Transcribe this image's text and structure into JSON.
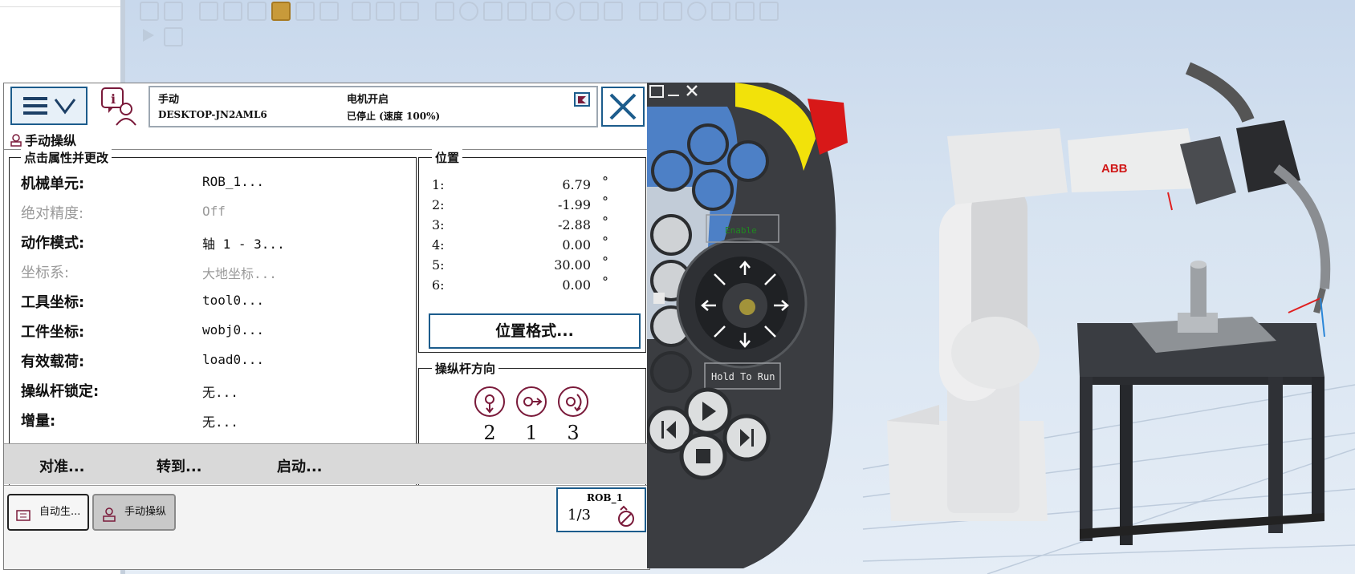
{
  "pendant": {
    "mode": "手动",
    "host": "DESKTOP-JN2AML6",
    "motor_state": "电机开启",
    "run_state": "已停止 (速度 100%)",
    "view_title": "手动操纵"
  },
  "properties": {
    "group_title": "点击属性并更改",
    "rows": [
      {
        "label": "机械单元:",
        "value": "ROB_1...",
        "enabled": true
      },
      {
        "label": "绝对精度:",
        "value": "Off",
        "enabled": false
      },
      {
        "label": "动作模式:",
        "value": "轴 1 - 3...",
        "enabled": true
      },
      {
        "label": "坐标系:",
        "value": "大地坐标...",
        "enabled": false
      },
      {
        "label": "工具坐标:",
        "value": "tool0...",
        "enabled": true
      },
      {
        "label": "工件坐标:",
        "value": "wobj0...",
        "enabled": true
      },
      {
        "label": "有效载荷:",
        "value": "load0...",
        "enabled": true
      },
      {
        "label": "操纵杆锁定:",
        "value": "无...",
        "enabled": true
      },
      {
        "label": "增量:",
        "value": "无...",
        "enabled": true
      }
    ]
  },
  "position": {
    "group_title": "位置",
    "unit": "°",
    "axes": [
      {
        "axis": "1:",
        "value": "6.79"
      },
      {
        "axis": "2:",
        "value": "-1.99"
      },
      {
        "axis": "3:",
        "value": "-2.88"
      },
      {
        "axis": "4:",
        "value": "0.00"
      },
      {
        "axis": "5:",
        "value": "30.00"
      },
      {
        "axis": "6:",
        "value": "0.00"
      }
    ],
    "format_button": "位置格式..."
  },
  "joystick": {
    "group_title": "操纵杆方向",
    "directions": [
      "2",
      "1",
      "3"
    ]
  },
  "commands": [
    "对准...",
    "转到...",
    "启动..."
  ],
  "taskbar": {
    "tasks": [
      "自动生...",
      "手动操纵"
    ],
    "mech_unit": "ROB_1",
    "speed_fraction": "1/3"
  },
  "device": {
    "enable_label": "Enable",
    "hold_label": "Hold To Run"
  },
  "scene": {
    "robot_brand": "ABB"
  }
}
